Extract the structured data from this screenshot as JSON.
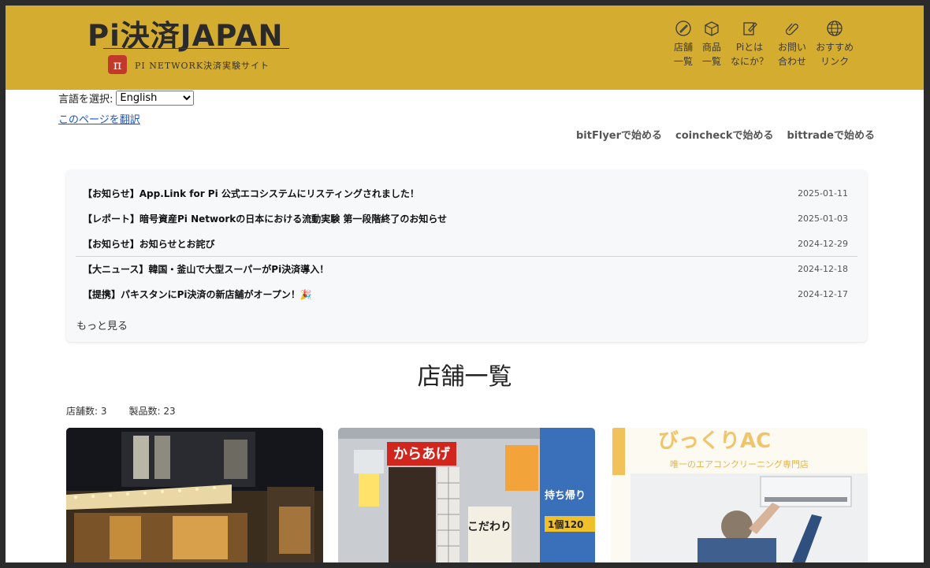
{
  "header": {
    "logo_title": "Pi決済JAPAN",
    "logo_badge": "π",
    "logo_subtitle": "PI NETWORK決済実験サイト",
    "nav": [
      {
        "label": "店舗\n一覧",
        "icon": "pencil-circle-icon"
      },
      {
        "label": "商品\n一覧",
        "icon": "box-icon"
      },
      {
        "label": "Piとは\nなにか？",
        "icon": "edit-document-icon"
      },
      {
        "label": "お問い\n合わせ",
        "icon": "paperclip-icon"
      },
      {
        "label": "おすすめ\nリンク",
        "icon": "globe-icon"
      }
    ]
  },
  "language": {
    "label": "言語を選択:",
    "selected": "English",
    "translate_link": "このページを翻訳"
  },
  "start_links": [
    "bitFlyerで始める",
    "coincheckで始める",
    "bittradeで始める"
  ],
  "news": {
    "items": [
      {
        "title": "【お知らせ】App.Link for Pi 公式エコシステムにリスティングされました！",
        "date": "2025-01-11"
      },
      {
        "title": "【レポート】暗号資産Pi Networkの日本における流動実験 第一段階終了のお知らせ",
        "date": "2025-01-03"
      },
      {
        "title": "【お知らせ】お知らせとお詫び",
        "date": "2024-12-29"
      },
      {
        "title": "【大ニュース】韓国・釜山で大型スーパーがPi決済導入！",
        "date": "2024-12-18"
      },
      {
        "title": "【提携】パキスタンにPi決済の新店舗がオープン！🎉",
        "date": "2024-12-17"
      }
    ],
    "more": "もっと見る"
  },
  "stores": {
    "title": "店舗一覧",
    "store_count": "店舗数: 3",
    "product_count": "製品数: 23",
    "card_texts": {
      "sign_karaage": "からあげ",
      "sign_takeout": "持ち帰り",
      "sign_price": "1個120",
      "sign_kodawari": "こだわり",
      "banner_title": "びっくりAC",
      "banner_sub": "唯一のエアコンクリーニング専門店"
    }
  },
  "colors": {
    "header_bg": "#d4ac2f",
    "link": "#1a56c8"
  }
}
